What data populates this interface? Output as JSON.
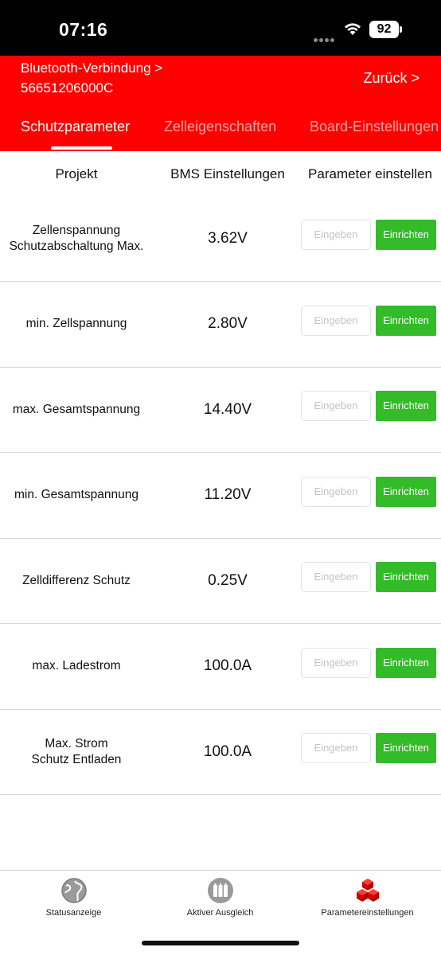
{
  "status_bar": {
    "time": "07:16",
    "battery": "92",
    "icons": [
      "signal-dots-icon",
      "wifi-icon",
      "battery-icon"
    ]
  },
  "header": {
    "bluetooth_line1": "Bluetooth-Verbindung >",
    "bluetooth_line2": "56651206000C",
    "back_label": "Zurück >",
    "background_color": "#ff0000"
  },
  "tabs": [
    {
      "label": "Schutzparameter",
      "active": true
    },
    {
      "label": "Zelleigenschaften",
      "active": false
    },
    {
      "label": "Board-Einstellungen",
      "active": false
    }
  ],
  "table": {
    "columns": [
      "Projekt",
      "BMS Einstellungen",
      "Parameter einstellen"
    ],
    "input_placeholder": "Eingeben",
    "apply_label": "Einrichten",
    "apply_color": "#33bb2a",
    "rows": [
      {
        "name": "Zellenspannung\nSchutzabschaltung Max.",
        "value": "3.62V"
      },
      {
        "name": "min. Zellspannung",
        "value": "2.80V"
      },
      {
        "name": "max. Gesamtspannung",
        "value": "14.40V"
      },
      {
        "name": "min. Gesamtspannung",
        "value": "11.20V"
      },
      {
        "name": "Zelldifferenz Schutz",
        "value": "0.25V"
      },
      {
        "name": "max. Ladestrom",
        "value": "100.0A"
      },
      {
        "name": "Max. Strom\nSchutz Entladen",
        "value": "100.0A"
      }
    ]
  },
  "bottom_nav": [
    {
      "label": "Statusanzeige",
      "icon": "globe-icon",
      "active": false
    },
    {
      "label": "Aktiver Ausgleich",
      "icon": "battery-pack-icon",
      "active": false
    },
    {
      "label": "Parametereinstellungen",
      "icon": "cubes-icon",
      "active": true
    }
  ]
}
